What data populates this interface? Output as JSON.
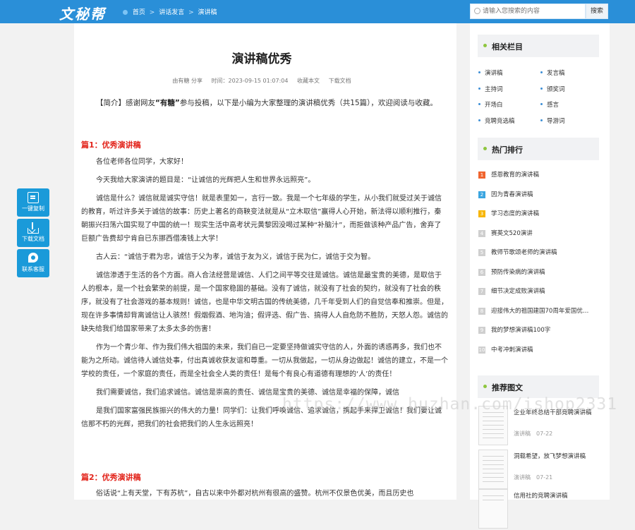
{
  "header": {
    "logo": "文秘帮",
    "breadcrumb": [
      "首页",
      "讲话发言",
      "演讲稿"
    ],
    "breadcrumb_sep": ">",
    "search_placeholder": "请输入您搜索的内容",
    "search_button": "搜索"
  },
  "article": {
    "title": "演讲稿优秀",
    "meta": [
      "由有糖 分享",
      "时间：2023-09-15 01:07:04",
      "收藏本文",
      "下载文档"
    ],
    "summary_prefix": "【简介】感谢网友",
    "summary_author": "“有糖”",
    "summary_text": "参与投稿，以下是小编为大家整理的演讲稿优秀（共15篇），欢迎阅读与收藏。",
    "section1_title": "篇1：优秀演讲稿",
    "section1_paragraphs": [
      "各位老师各位同学，大家好！",
      "今天我给大家演讲的题目是：“让诚信的光辉把人生和世界永远照亮”。",
      "诚信是什么？诚信就是诚实守信！就是表里如一，言行一致。我是一个七年级的学生，从小我们就受过关于诚信的教育，听过许多关于诚信的故事：历史上著名的商鞅变法就是从“立木取信”赢得人心开始，新法得以顺利推行，秦朝振兴扫荡六国实现了中国的统一！现实生活中高考状元黄黎因没喝过某种“补脑汁”，而拒做该种产品广告，舍弃了巨额广告费却宁肯自已东挪西借凑钱上大学！",
      "古人云：“诚信于君为忠，诚信于父为孝，诚信于友为义，诚信于民为仁，诚信于交为智。",
      "诚信渗透于生活的各个方面。商人合法经营是诚信、人们之间平等交往是诚信。诚信是最宝贵的美德，是取信于人的根本，是一个社会繁荣的前提，是一个国家稳固的基础。没有了诚信，就没有了社会的契约，就没有了社会的秩序，就没有了社会游戏的基本规则！诚信，也是中华文明古国的传统美德，几千年受到人们的自觉信奉和推崇。但是，现在许多事情却背离诚信让人骇然！假烟假酒、地沟油；假评选、假广告、搞得人人自危防不胜防，天怒人怨。诚信的缺失给我们给国家带来了太多太多的伤害！",
      "作为一个青少年、作为我们伟大祖国的未来，我们自已一定要坚持做诚实守信的人，外面的诱惑再多，我们也不能为之所动。诚信待人诚信处事，付出真诚收获友谊和尊重。一切从我做起，一切从身边做起！诚信的建立，不是一个学校的责任，一个家庭的责任，而是全社会全人类的责任！是每个有良心有道德有理想的‘人’的责任！",
      "我们需要诚信，我们追求诚信。诚信是崇高的责任、诚信是宝贵的美德、诚信是幸福的保障，诚信",
      "是我们国家富强民族振兴的伟大的力量！同学们：让我们呼唤诚信、追求诚信，携起手来捍卫诚信！我们要让诚信那不朽的光辉，把我们的社会把我们的人生永远照亮！"
    ],
    "section2_title": "篇2：优秀演讲稿",
    "section2_paragraphs": [
      "俗话说“上有天堂，下有苏杭”，自古以来中外都对杭州有很高的盛赞。杭州不仅景色优美，而且历史也"
    ]
  },
  "float_tools": [
    "一键复制",
    "下载文档",
    "联系客服"
  ],
  "sidebar": {
    "related_title": "相关栏目",
    "related_items": [
      "演讲稿",
      "发言稿",
      "主持词",
      "颁奖词",
      "开场白",
      "感言",
      "竞聘竞选稿",
      "导游词"
    ],
    "hot_title": "热门排行",
    "hot_items": [
      "感恩教育的演讲稿",
      "因为青春演讲稿",
      "学习态度的演讲稿",
      "赛英文520演讲",
      "教师节歌颂老师的演讲稿",
      "预防传染病的演讲稿",
      "细节决定成败演讲稿",
      "迎接伟大的祖国建国70周年爱国优…",
      "我的梦想演讲稿100字",
      "中考冲刺演讲稿"
    ],
    "hot_numbers": [
      "1",
      "2",
      "3",
      "4",
      "5",
      "6",
      "7",
      "8",
      "9",
      "10"
    ],
    "hot_colors": [
      "#f0642e",
      "#3aa5e0",
      "#f7b500",
      "#cfcfcf",
      "#cfcfcf",
      "#cfcfcf",
      "#cfcfcf",
      "#cfcfcf",
      "#cfcfcf",
      "#cfcfcf"
    ],
    "rec_title": "推荐图文",
    "rec_items": [
      {
        "title": "企业年终总结干部竞聘演讲稿",
        "cat": "演讲稿",
        "date": "07-22"
      },
      {
        "title": "洞载希望，放飞梦想演讲稿",
        "cat": "演讲稿",
        "date": "07-21"
      },
      {
        "title": "信用社的竞聘演讲稿",
        "cat": "",
        "date": ""
      }
    ]
  },
  "watermark": "https://www.huzhan.com/ishop2331"
}
